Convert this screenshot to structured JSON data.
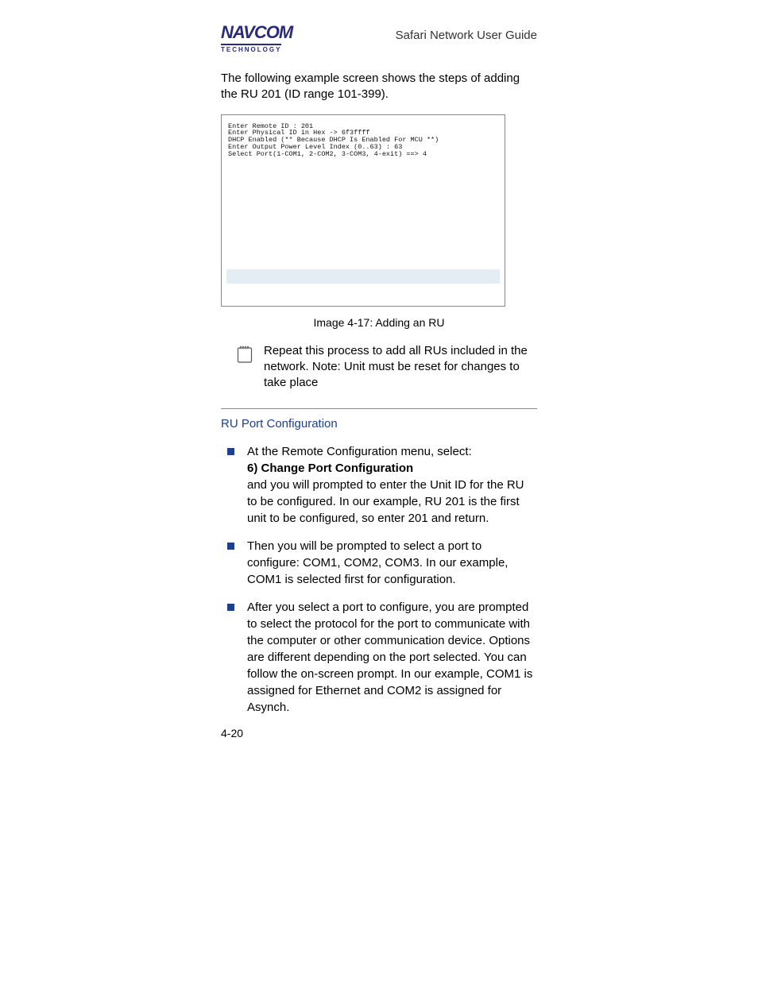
{
  "header": {
    "logo_main": "NAVCOM",
    "logo_sub": "TECHNOLOGY",
    "doc_title": "Safari Network User Guide"
  },
  "intro": "The following example screen shows the steps of adding the RU 201 (ID range 101-399).",
  "terminal": {
    "lines": [
      "Enter Remote ID : 201",
      "Enter Physical ID in Hex -> 6f3ffff",
      "DHCP Enabled (** Because DHCP Is Enabled For MCU **)",
      "Enter Output Power Level Index (0..63) : 63",
      "Select Port(1-COM1, 2-COM2, 3-COM3, 4-exit) ==> 4"
    ]
  },
  "caption": "Image 4-17: Adding an RU",
  "note": "Repeat this process to add all RUs included in the network.  Note: Unit must be reset for changes to take place",
  "section_heading": "RU Port Configuration",
  "bullets": [
    {
      "line1": "At the Remote Configuration menu, select:",
      "strong": "6) Change Port Configuration",
      "rest": "and you will prompted to enter the Unit ID for the RU to be configured. In our example, RU 201 is the first unit to be configured, so enter 201 and return."
    },
    {
      "line1": "Then you will be prompted to select a port to configure: COM1, COM2, COM3. In our example, COM1 is selected first for configuration."
    },
    {
      "line1": "After you select a port to configure, you are prompted to select the protocol for the port to communicate with the computer or other communication device. Options are different depending on the port selected. You can follow the on-screen prompt. In our example, COM1 is assigned for Ethernet and COM2 is assigned for Asynch."
    }
  ],
  "page_number": "4-20"
}
